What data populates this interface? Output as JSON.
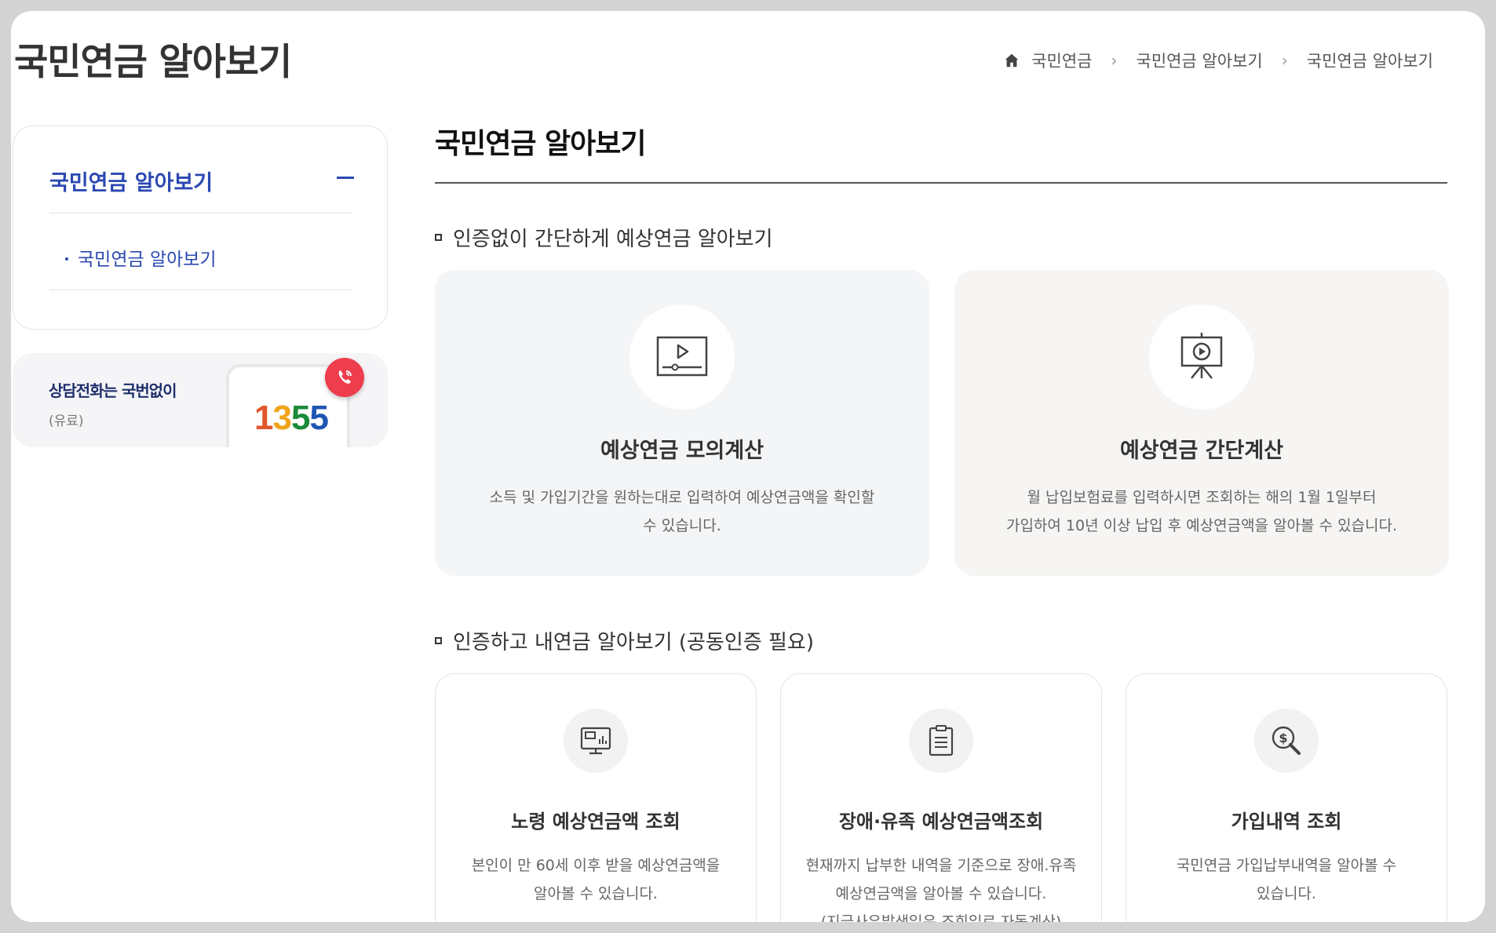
{
  "header": {
    "page_title": "국민연금 알아보기",
    "breadcrumb": [
      "국민연금",
      "국민연금 알아보기",
      "국민연금 알아보기"
    ]
  },
  "sidebar": {
    "menu_head": "국민연금 알아보기",
    "sub_items": [
      {
        "label": "국민연금 알아보기"
      }
    ]
  },
  "call_banner": {
    "text": "상담전화는 국번없이",
    "sub": "(유료)",
    "number_digits": [
      "1",
      "3",
      "5",
      "5"
    ]
  },
  "main": {
    "title": "국민연금 알아보기",
    "section1": {
      "heading": "인증없이 간단하게 예상연금 알아보기",
      "cards": [
        {
          "title": "예상연금 모의계산",
          "desc": [
            "소득 및 가입기간을 원하는대로 입력하여 예상연금액을 확인할",
            "수 있습니다."
          ],
          "icon": "video-player-icon"
        },
        {
          "title": "예상연금 간단계산",
          "desc": [
            "월 납입보험료를 입력하시면 조회하는 해의 1월 1일부터",
            "가입하여 10년 이상 납입 후 예상연금액을 알아볼 수 있습니다."
          ],
          "icon": "presentation-play-icon"
        }
      ]
    },
    "section2": {
      "heading": "인증하고 내연금 알아보기 (공동인증 필요)",
      "cards": [
        {
          "title": "노령 예상연금액 조회",
          "desc": [
            "본인이 만 60세 이후 받을 예상연금액을",
            "알아볼 수 있습니다."
          ],
          "icon": "monitor-chart-icon"
        },
        {
          "title": "장애·유족 예상연금액조회",
          "desc": [
            "현재까지 납부한 내역을 기준으로 장애.유족",
            "예상연금액을 알아볼 수 있습니다.",
            "(지급사유발생일은 조회일로 자동계산)"
          ],
          "icon": "clipboard-icon"
        },
        {
          "title": "가입내역 조회",
          "desc": [
            "국민연금 가입납부내역을 알아볼 수",
            "있습니다."
          ],
          "icon": "money-search-icon"
        }
      ]
    }
  },
  "colors": {
    "accent": "#2b48b2",
    "call_badge": "#ee3d4d"
  }
}
